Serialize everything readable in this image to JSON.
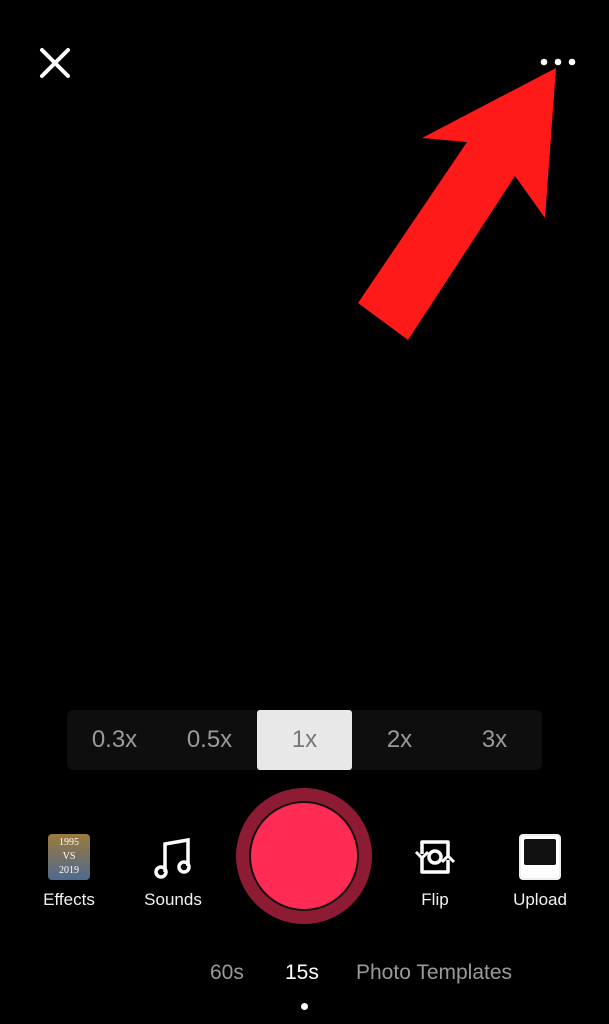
{
  "top_bar": {
    "close_icon": "close-x-icon",
    "more_icon": "more-dots-icon"
  },
  "annotation": {
    "arrow_color": "#ff1a1a",
    "points_to": "more-options"
  },
  "zoom_levels": [
    {
      "label": "0.3x"
    },
    {
      "label": "0.5x"
    },
    {
      "label": "1x",
      "selected": true
    },
    {
      "label": "2x"
    },
    {
      "label": "3x"
    }
  ],
  "tools": {
    "effects": {
      "label": "Effects",
      "thumb_text": "1995 VS 2019"
    },
    "sounds": {
      "label": "Sounds",
      "icon": "music-note-icon"
    },
    "flip": {
      "label": "Flip",
      "icon": "flip-camera-icon"
    },
    "upload": {
      "label": "Upload"
    }
  },
  "record": {
    "color": "#fe2c55",
    "ring_color": "#8e1b34"
  },
  "modes": [
    {
      "label": "60s"
    },
    {
      "label": "15s",
      "active": true
    },
    {
      "label": "Photo Templates"
    }
  ]
}
